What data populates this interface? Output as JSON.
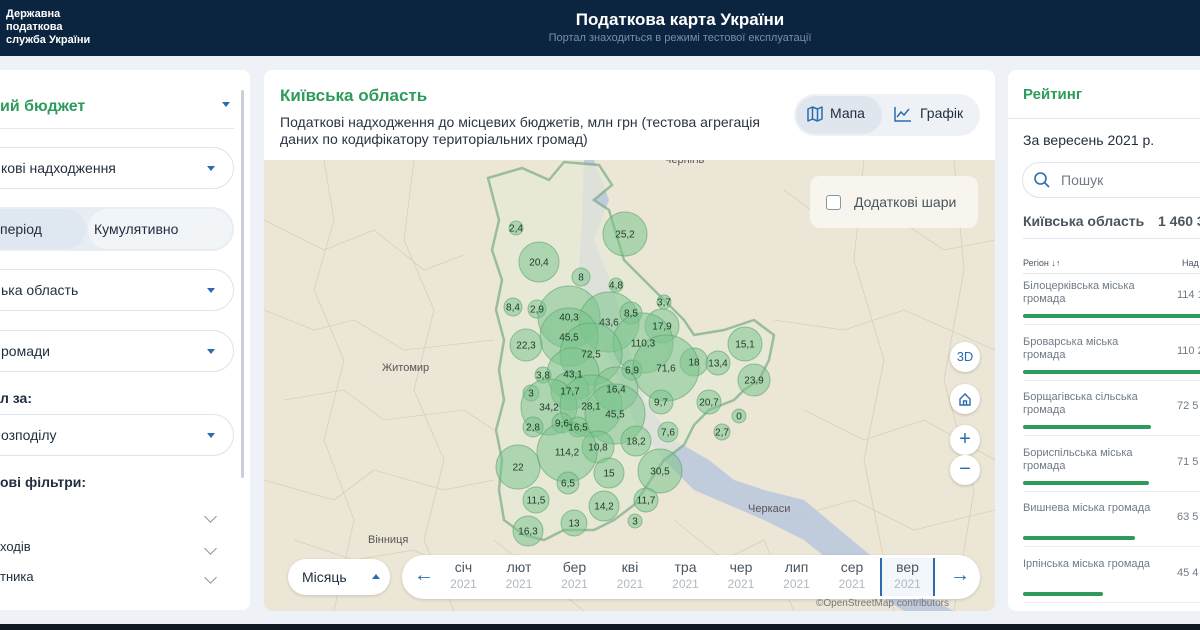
{
  "header": {
    "logo_lines": [
      "Державна",
      "податкова",
      "служба України"
    ],
    "title": "Податкова карта України",
    "subtitle": "Портал знаходиться в режимі тестової експлуатації"
  },
  "left_panel": {
    "budget": "ий бюджет",
    "revenue_select": "кові надходження",
    "period_tabs": [
      "період",
      "Кумулятивно"
    ],
    "region_select": "ька область",
    "community_select": "ромади",
    "group_label": "л за:",
    "distribution_select": "озподілу",
    "filters_label": "ові фільтри:",
    "filter_items": [
      "",
      "ходів",
      "тника"
    ]
  },
  "map": {
    "title": "Київська область",
    "description": "Податкові надходження до місцевих бюджетів, млн грн (тестова агрегація даних по кодифікатору територіальних громад)",
    "view_map": "Мапа",
    "view_chart": "Графік",
    "layers_label": "Додаткові шари",
    "btn_3d": "3D",
    "zoom_in": "+",
    "zoom_out": "−",
    "attribution": "©OpenStreetMap contributors",
    "cities": [
      "Житомир",
      "Вінниця",
      "Черкаси",
      "Чернігів"
    ],
    "bubbles": [
      "25,2",
      "2,4",
      "20,4",
      "8",
      "4,8",
      "8,4",
      "2,9",
      "40,3",
      "43,6",
      "8,5",
      "3,7",
      "17,9",
      "45,5",
      "110,3",
      "15,1",
      "22,3",
      "72,5",
      "18",
      "13,4",
      "43,1",
      "6,9",
      "71,6",
      "23,9",
      "3,8",
      "17,7",
      "16,4",
      "20,7",
      "3",
      "34,2",
      "28,1",
      "45,5",
      "9,7",
      "0",
      "2,8",
      "9,6",
      "16,5",
      "7,6",
      "2,7",
      "10,8",
      "18,2",
      "22",
      "114,2",
      "15",
      "30,5",
      "6,5",
      "11,5",
      "14,2",
      "11,7",
      "16,3",
      "13",
      "3"
    ]
  },
  "timeline": {
    "period_select": "Місяць",
    "months": [
      {
        "m": "січ",
        "y": "2021"
      },
      {
        "m": "лют",
        "y": "2021"
      },
      {
        "m": "бер",
        "y": "2021"
      },
      {
        "m": "кві",
        "y": "2021"
      },
      {
        "m": "тра",
        "y": "2021"
      },
      {
        "m": "чер",
        "y": "2021"
      },
      {
        "m": "лип",
        "y": "2021"
      },
      {
        "m": "сер",
        "y": "2021"
      },
      {
        "m": "вер",
        "y": "2021"
      }
    ],
    "active_index": 8
  },
  "rating": {
    "title": "Рейтинг",
    "period": "За вересень 2021 р.",
    "search_placeholder": "Пошук",
    "region_name": "Київська область",
    "region_value": "1 460 3",
    "col_region": "Регіон ↓↑",
    "col_value": "Над",
    "rows": [
      {
        "name": "Білоцерківська міська громада",
        "value": "114 1",
        "share": 1.0
      },
      {
        "name": "Броварська міська громада",
        "value": "110 2",
        "share": 0.97
      },
      {
        "name": "Борщагівська сільська громада",
        "value": "72 5",
        "share": 0.64
      },
      {
        "name": "Бориспільська міська громада",
        "value": "71 5",
        "share": 0.63
      },
      {
        "name": "Вишнева міська громада",
        "value": "63 5",
        "share": 0.56
      },
      {
        "name": "Ірпінська міська громада",
        "value": "45 4",
        "share": 0.4
      }
    ]
  },
  "colors": {
    "header_bg": "#0b2440",
    "accent_green": "#2e9b5c",
    "accent_blue": "#2b6cb0",
    "bubble_fill": "#7cc48e"
  }
}
